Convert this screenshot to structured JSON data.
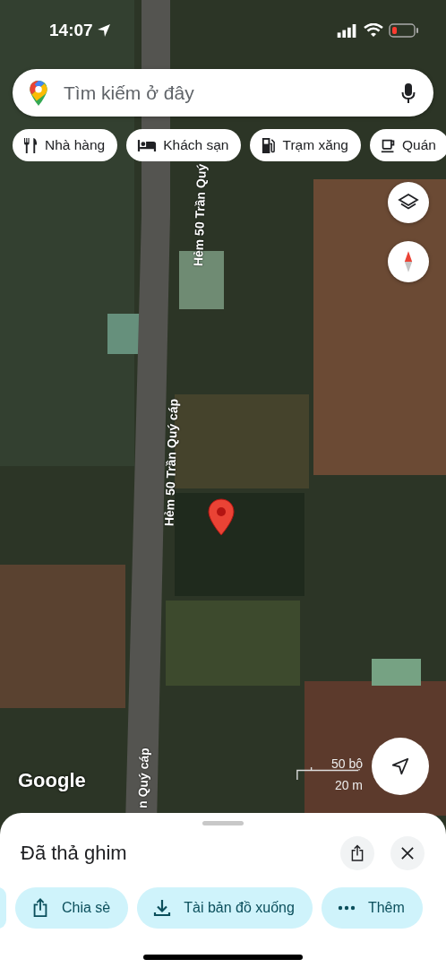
{
  "status_bar": {
    "time": "14:07"
  },
  "search": {
    "placeholder": "Tìm kiếm ở đây"
  },
  "chips": [
    {
      "label": "Nhà hàng",
      "kind": "restaurant"
    },
    {
      "label": "Khách sạn",
      "kind": "hotel"
    },
    {
      "label": "Trạm xăng",
      "kind": "gas"
    },
    {
      "label": "Quán",
      "kind": "cafe"
    }
  ],
  "map_labels": [
    "Hẻm 50 Trần Quý",
    "Hẻm 50 Trần Quý cáp",
    "n Quý cáp"
  ],
  "attribution": "Google",
  "scale": {
    "imperial": "50 bộ",
    "metric": "20 m"
  },
  "sheet": {
    "title": "Đã thả ghim",
    "actions": [
      {
        "kind": "partial"
      },
      {
        "label": "Chia sè",
        "kind": "share"
      },
      {
        "label": "Tài bản đồ xuống",
        "kind": "download"
      },
      {
        "label": "Thêm",
        "kind": "more"
      }
    ]
  }
}
